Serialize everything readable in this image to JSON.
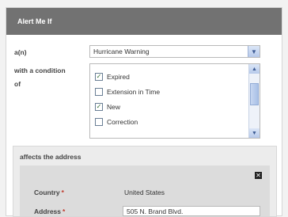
{
  "header": {
    "title": "Alert Me If"
  },
  "alert_type": {
    "label": "a(n)",
    "selected": "Hurricane Warning"
  },
  "condition": {
    "label_line1": "with a condition",
    "label_line2": "of",
    "options": [
      {
        "label": "Expired",
        "checked": true
      },
      {
        "label": "Extension in Time",
        "checked": false
      },
      {
        "label": "New",
        "checked": true
      },
      {
        "label": "Correction",
        "checked": false
      }
    ]
  },
  "address": {
    "section_title": "affects the address",
    "country_label": "Country",
    "country_value": "United States",
    "address_label": "Address",
    "address_value": "505 N. Brand Blvd.",
    "required_mark": "*"
  },
  "icons": {
    "dropdown": "chevron-down-icon",
    "close": "close-icon",
    "scroll_up": "chevron-up-icon",
    "scroll_down": "chevron-down-icon"
  },
  "colors": {
    "header_bg": "#727272",
    "required": "#c0392b",
    "control_blue": "#b6c9ea"
  }
}
